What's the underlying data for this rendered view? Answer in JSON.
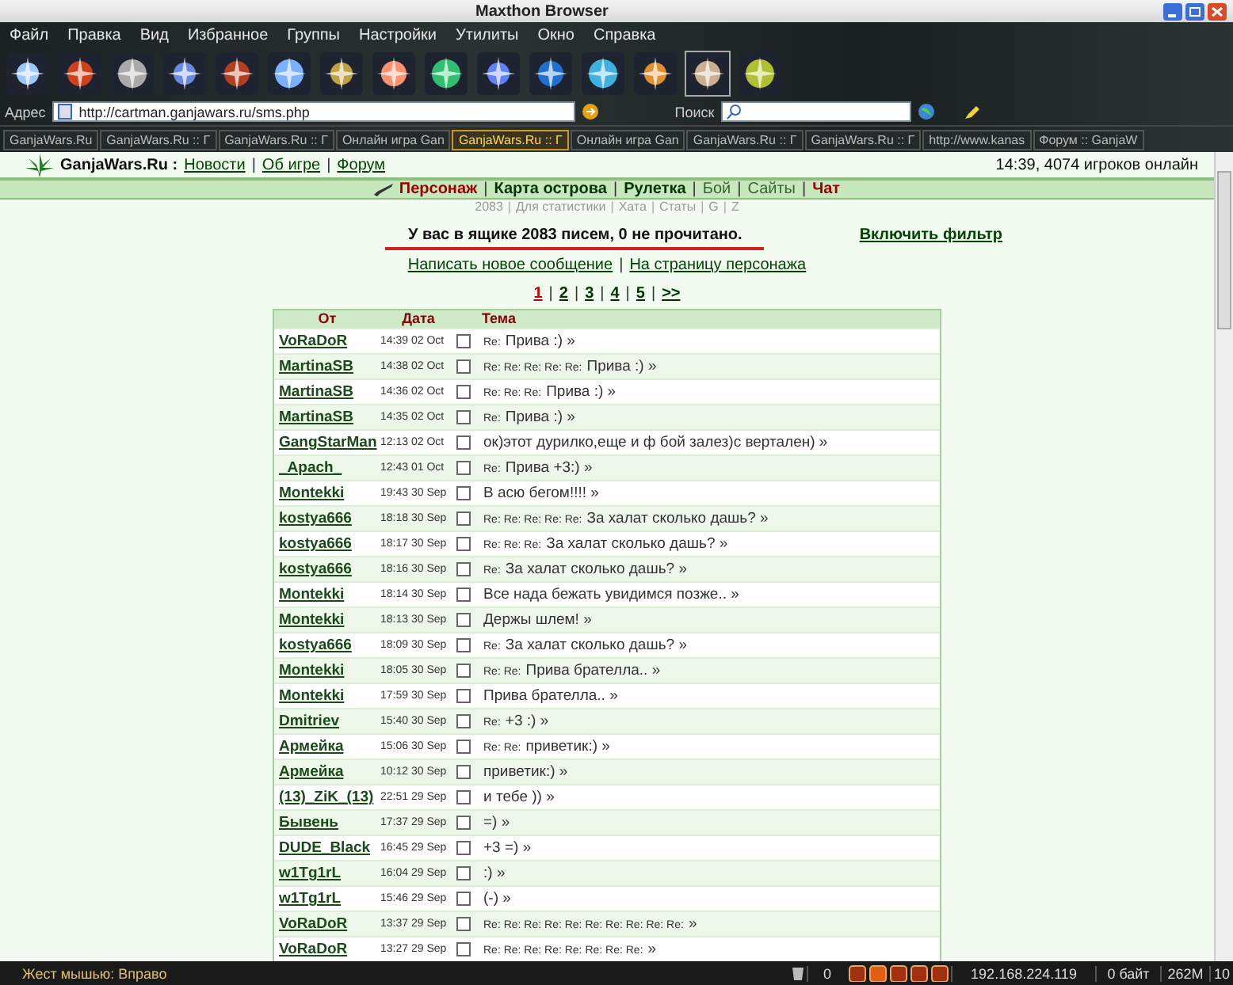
{
  "window": {
    "title": "Maxthon Browser"
  },
  "menu": [
    "Файл",
    "Правка",
    "Вид",
    "Избранное",
    "Группы",
    "Настройки",
    "Утилиты",
    "Окно",
    "Справка"
  ],
  "address": {
    "label": "Адрес",
    "value": "http://cartman.ganjawars.ru/sms.php"
  },
  "search": {
    "label": "Поиск"
  },
  "tabs": [
    {
      "label": "GanjaWars.Ru",
      "selected": false
    },
    {
      "label": "GanjaWars.Ru :: Г",
      "selected": false
    },
    {
      "label": "GanjaWars.Ru :: Г",
      "selected": false
    },
    {
      "label": "Онлайн игра Gan",
      "selected": false
    },
    {
      "label": "GanjaWars.Ru :: Г",
      "selected": true
    },
    {
      "label": "Онлайн игра Gan",
      "selected": false
    },
    {
      "label": "GanjaWars.Ru :: Г",
      "selected": false
    },
    {
      "label": "GanjaWars.Ru :: Г",
      "selected": false
    },
    {
      "label": "http://www.kanas",
      "selected": false
    },
    {
      "label": "Форум :: GanjaW",
      "selected": false
    }
  ],
  "site": {
    "logo": "GanjaWars.Ru :",
    "separator": "|",
    "links": [
      "Новости",
      "Об игре",
      "Форум"
    ],
    "online": "14:39, 4074 игроков онлайн"
  },
  "nav_separator": "|",
  "nav": [
    {
      "label": "Персонаж",
      "kind": "active"
    },
    {
      "label": "Карта острова",
      "kind": "bold"
    },
    {
      "label": "Рулетка",
      "kind": "bold"
    },
    {
      "label": "Бой",
      "kind": "plain"
    },
    {
      "label": "Сайты",
      "kind": "plain"
    },
    {
      "label": "Чат",
      "kind": "alert"
    }
  ],
  "subnav_separator": "|",
  "subnav": [
    "2083",
    "Для статистики",
    "Хата",
    "Статы",
    "G",
    "Z"
  ],
  "mailbox": {
    "separator": "|",
    "summary": "У вас в ящике 2083 писем, 0 не прочитано.",
    "filter": "Включить фильтр",
    "actions": [
      "Написать новое сообщение",
      "На страницу персонажа"
    ]
  },
  "pages_separator": "|",
  "pages": [
    {
      "label": "1",
      "selected": true
    },
    {
      "label": "2",
      "selected": false
    },
    {
      "label": "3",
      "selected": false
    },
    {
      "label": "4",
      "selected": false
    },
    {
      "label": "5",
      "selected": false
    },
    {
      "label": ">>",
      "selected": false
    }
  ],
  "table": {
    "columns": [
      "От",
      "Дата",
      "Тема"
    ],
    "rows": [
      {
        "from": "VoRaDoR",
        "date": "14:39 02 Oct",
        "re": "Re:",
        "subject": "Прива :) »",
        "checked": false
      },
      {
        "from": "MartinaSB",
        "date": "14:38 02 Oct",
        "re": "Re: Re: Re: Re: Re:",
        "subject": "Прива :) »",
        "checked": false
      },
      {
        "from": "MartinaSB",
        "date": "14:36 02 Oct",
        "re": "Re: Re: Re:",
        "subject": "Прива :) »",
        "checked": false
      },
      {
        "from": "MartinaSB",
        "date": "14:35 02 Oct",
        "re": "Re:",
        "subject": "Прива :) »",
        "checked": false
      },
      {
        "from": "GangStarMan",
        "date": "12:13 02 Oct",
        "subject": "ок)этот дурилко,еще и ф бой залез)с вертален) »",
        "checked": false
      },
      {
        "from": "_Apach_",
        "date": "12:43 01 Oct",
        "re": "Re:",
        "subject": "Прива +3:) »",
        "checked": false
      },
      {
        "from": "Montekki",
        "date": "19:43 30 Sep",
        "subject": "В асю бегом!!!! »",
        "checked": false
      },
      {
        "from": "kostya666",
        "date": "18:18 30 Sep",
        "re": "Re: Re: Re: Re: Re:",
        "subject": "За халат сколько дашь? »",
        "checked": false
      },
      {
        "from": "kostya666",
        "date": "18:17 30 Sep",
        "re": "Re: Re: Re:",
        "subject": "За халат сколько дашь? »",
        "checked": false
      },
      {
        "from": "kostya666",
        "date": "18:16 30 Sep",
        "re": "Re:",
        "subject": "За халат сколько дашь? »",
        "checked": false
      },
      {
        "from": "Montekki",
        "date": "18:14 30 Sep",
        "subject": "Все нада бежать увидимся позже.. »",
        "checked": false
      },
      {
        "from": "Montekki",
        "date": "18:13 30 Sep",
        "subject": "Держы шлем! »",
        "checked": false
      },
      {
        "from": "kostya666",
        "date": "18:09 30 Sep",
        "re": "Re:",
        "subject": "За халат сколько дашь? »",
        "checked": false
      },
      {
        "from": "Montekki",
        "date": "18:05 30 Sep",
        "re": "Re: Re:",
        "subject": "Прива брателла.. »",
        "checked": false
      },
      {
        "from": "Montekki",
        "date": "17:59 30 Sep",
        "subject": "Прива брателла.. »",
        "checked": false
      },
      {
        "from": "Dmitriev",
        "date": "15:40 30 Sep",
        "re": "Re:",
        "subject": "+3 :) »",
        "checked": false
      },
      {
        "from": "Армейка",
        "date": "15:06 30 Sep",
        "re": "Re: Re:",
        "subject": "приветик:) »",
        "checked": false
      },
      {
        "from": "Армейка",
        "date": "10:12 30 Sep",
        "subject": "приветик:) »",
        "checked": false
      },
      {
        "from": "(13)_ZiK_(13)",
        "date": "22:51 29 Sep",
        "subject": "и тебе )) »",
        "checked": false
      },
      {
        "from": "Бывень",
        "date": "17:37 29 Sep",
        "subject": "=) »",
        "checked": false
      },
      {
        "from": "DUDE_Black",
        "date": "16:45 29 Sep",
        "subject": "+3 =) »",
        "checked": false
      },
      {
        "from": "w1Tg1rL",
        "date": "16:04 29 Sep",
        "subject": ":) »",
        "checked": false
      },
      {
        "from": "w1Tg1rL",
        "date": "15:46 29 Sep",
        "subject": "(-) »",
        "checked": false
      },
      {
        "from": "VoRaDoR",
        "date": "13:37 29 Sep",
        "re": "Re: Re: Re: Re: Re: Re: Re: Re: Re: Re:",
        "subject": "»",
        "checked": false
      },
      {
        "from": "VoRaDoR",
        "date": "13:27 29 Sep",
        "re": "Re: Re: Re: Re: Re: Re: Re: Re:",
        "subject": "»",
        "checked": false
      }
    ]
  },
  "status": {
    "text": "Жест мышью: Вправо",
    "count": "0",
    "ip": "192.168.224.119",
    "traffic": "0 байт",
    "memory": "262M",
    "number": "10"
  }
}
